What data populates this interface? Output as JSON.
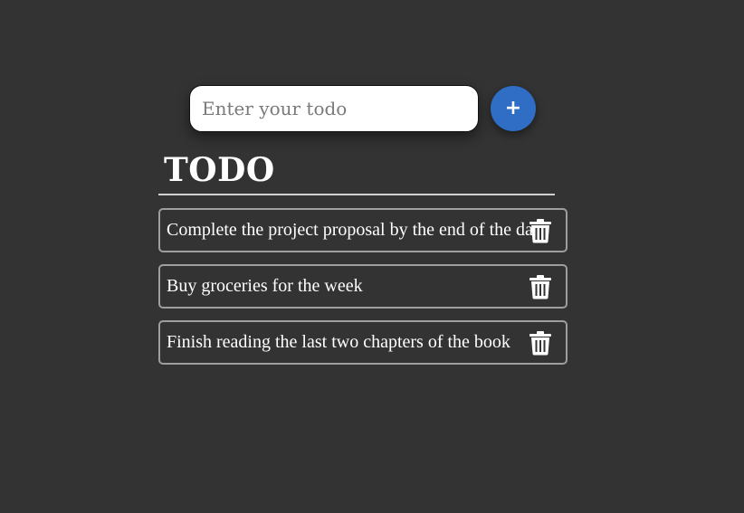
{
  "input": {
    "placeholder": "Enter your todo",
    "value": ""
  },
  "add_button": {
    "label": "+",
    "color": "#2f6ec4"
  },
  "heading": "TODO",
  "todos": [
    {
      "text": "Complete the project proposal by the end of the day",
      "icon": "trash-icon"
    },
    {
      "text": "Buy groceries for the week",
      "icon": "trash-icon"
    },
    {
      "text": "Finish reading the last two chapters of the book",
      "icon": "trash-icon"
    }
  ],
  "colors": {
    "background": "#333333",
    "text": "#ffffff",
    "item_border": "#9e9e9e"
  }
}
